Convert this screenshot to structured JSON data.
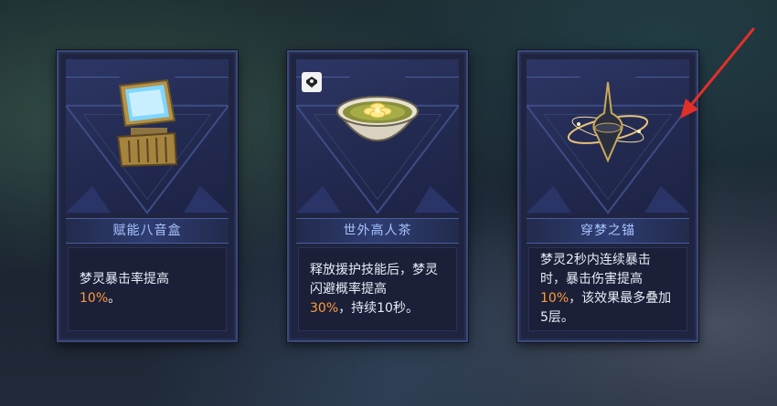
{
  "cards": [
    {
      "name": "赋能八音盒",
      "desc_pre": "梦灵暴击率提高",
      "desc_hl": "10%",
      "desc_post": "。",
      "icon": "music-box-icon",
      "has_badge": false
    },
    {
      "name": "世外高人茶",
      "desc_pre": "释放援护技能后，梦灵闪避概率提高",
      "desc_hl": "30%",
      "desc_post": "，持续10秒。",
      "icon": "tea-bowl-icon",
      "has_badge": true,
      "badge_icon": "support-badge-icon"
    },
    {
      "name": "穿梦之锚",
      "desc_pre": "梦灵2秒内连续暴击时，暴击伤害提高",
      "desc_hl": "10%",
      "desc_post": "，该效果最多叠加5层。",
      "icon": "dream-anchor-icon",
      "has_badge": false
    }
  ],
  "colors": {
    "title_text": "#a9c3ff",
    "highlight": "#ff9a3b",
    "annotation_arrow": "#e0302a"
  }
}
